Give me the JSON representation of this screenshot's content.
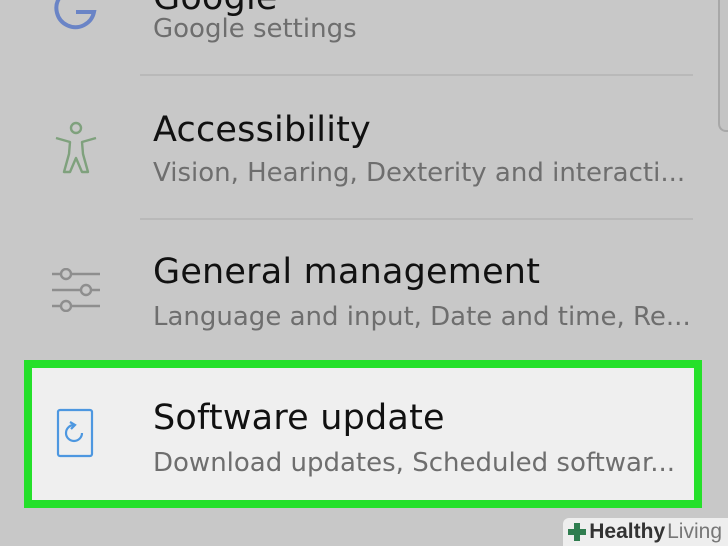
{
  "settings_list": {
    "items": [
      {
        "id": "google",
        "title": "Google",
        "subtitle": "Google settings",
        "icon": "google-g-icon"
      },
      {
        "id": "accessibility",
        "title": "Accessibility",
        "subtitle": "Vision, Hearing, Dexterity and interacti...",
        "icon": "accessibility-person-icon"
      },
      {
        "id": "general-management",
        "title": "General management",
        "subtitle": "Language and input, Date and time, Re...",
        "icon": "sliders-icon"
      },
      {
        "id": "software-update",
        "title": "Software update",
        "subtitle": "Download updates, Scheduled softwar...",
        "icon": "phone-refresh-icon"
      }
    ]
  },
  "highlight_color": "#25e02a",
  "watermark": {
    "part1": "Healthy",
    "part2": "Living"
  }
}
